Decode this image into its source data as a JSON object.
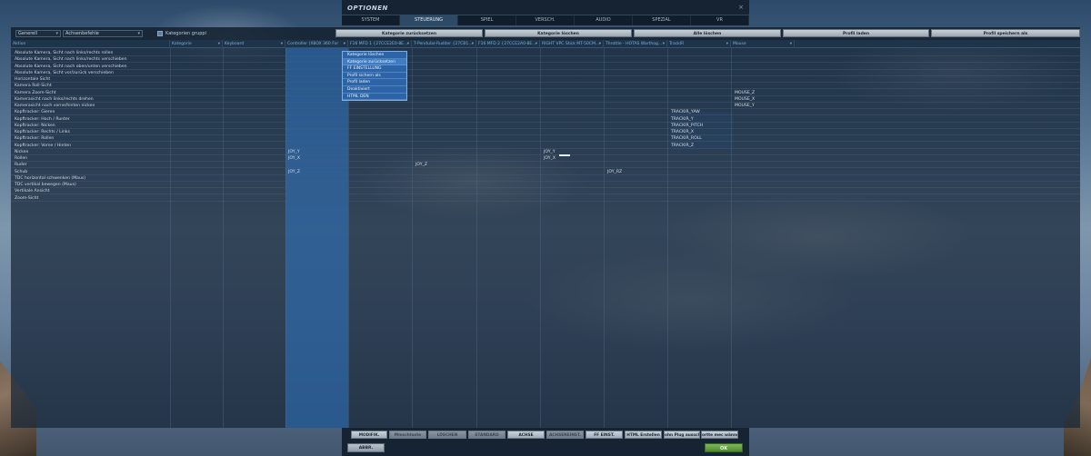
{
  "window": {
    "title": "OPTIONEN",
    "close": "×"
  },
  "tabs": [
    "SYSTEM",
    "STEUERUNG",
    "SPIEL",
    "VERSCH.",
    "AUDIO",
    "SPEZIAL",
    "VR"
  ],
  "active_tab": "STEUERUNG",
  "toolbar": {
    "aircraft_select": "Generell",
    "category_select": "Achsenbefehle",
    "group_checkbox_label": "Kategorien gruppi",
    "buttons": [
      "Kategorie zurücksetzen",
      "Kategorie löschen",
      "Alle löschen",
      "Profil laden",
      "Profil speichern als"
    ]
  },
  "columns": [
    "Aktion",
    "Kategorie",
    "Keyboard",
    "Controller (XBOX 360 For",
    "F16 MFD 1 {27CCE2E0-8E...",
    "T-Pendular-Rudder {27CB1...",
    "F16 MFD 2 {27CCE2A0-8E...",
    "RIGHT VPC Stick MT-50CM...",
    "Throttle - HOTAS Warthog...",
    "TrackIR",
    "Mouse"
  ],
  "rows": [
    {
      "action": "Absolute Kamera, Sicht nach links/rechts rollen",
      "values": {}
    },
    {
      "action": "Absolute Kamera, Sicht nach links/rechts verschieben",
      "values": {}
    },
    {
      "action": "Absolute Kamera, Sicht nach oben/unten verschieben",
      "values": {}
    },
    {
      "action": "Absolute Kamera, Sicht vor/zurück verschieben",
      "values": {}
    },
    {
      "action": "Horizontale Sicht",
      "values": {}
    },
    {
      "action": "Kamera Roll-Sicht",
      "values": {}
    },
    {
      "action": "Kamera Zoom-Sicht",
      "values": {
        "mouse": "MOUSE_Z"
      }
    },
    {
      "action": "Kamerasicht nach links/rechts drehen",
      "values": {
        "mouse": "MOUSE_X"
      }
    },
    {
      "action": "Kamerasicht nach vorne/hinten nicken",
      "values": {
        "mouse": "MOUSE_Y"
      }
    },
    {
      "action": "Kopftracker: Gieren",
      "values": {
        "trackir": "TRACKIR_YAW"
      }
    },
    {
      "action": "Kopftracker: Hoch / Runter",
      "values": {
        "trackir": "TRACKIR_Y"
      }
    },
    {
      "action": "Kopftracker: Nicken",
      "values": {
        "trackir": "TRACKIR_PITCH"
      }
    },
    {
      "action": "Kopftracker: Rechts / Links",
      "values": {
        "trackir": "TRACKIR_X"
      }
    },
    {
      "action": "Kopftracker: Rollen",
      "values": {
        "trackir": "TRACKIR_ROLL"
      }
    },
    {
      "action": "Kopftracker: Vorne / Hinten",
      "values": {
        "trackir": "TRACKIR_Z"
      }
    },
    {
      "action": "Nicken",
      "values": {
        "xbox": "JOY_Y",
        "stick": "JOY_Y"
      }
    },
    {
      "action": "Rollen",
      "values": {
        "xbox": "JOY_X",
        "stick": "JOY_X"
      }
    },
    {
      "action": "Ruder",
      "values": {
        "rudder": "JOY_Z"
      }
    },
    {
      "action": "Schub",
      "values": {
        "xbox": "JOY_Z",
        "throttle": "JOY_RZ"
      }
    },
    {
      "action": "TDC horizontal schwenken (Maus)",
      "values": {}
    },
    {
      "action": "TDC vertikal bewegen (Maus)",
      "values": {}
    },
    {
      "action": "Vertikale Ansicht",
      "values": {}
    },
    {
      "action": "Zoom-Sicht",
      "values": {}
    }
  ],
  "context_menu": [
    "Kategorie löschen",
    "Kategorie zurücksetzen",
    "FF EINSTELLUNG",
    "Profil sichern als",
    "Profil laden",
    "Deaktiviert",
    "HTML DEN"
  ],
  "bottom_buttons": [
    {
      "label": "MODIFIK.",
      "enabled": true
    },
    {
      "label": "Mmschtaste",
      "enabled": false
    },
    {
      "label": "LÖSCHEN",
      "enabled": false
    },
    {
      "label": "STANDARD",
      "enabled": false
    },
    {
      "label": "ACHSE",
      "enabled": true
    },
    {
      "label": "ACHSENEINST.",
      "enabled": false
    },
    {
      "label": "FF EINST.",
      "enabled": true
    },
    {
      "label": "HTML Erstellen",
      "enabled": true
    },
    {
      "label": "ohn Plug ausschalte",
      "enabled": true
    },
    {
      "label": "ortte mec wänne",
      "enabled": true
    }
  ],
  "footer": {
    "cancel": "ABBR.",
    "ok": "OK"
  },
  "colors": {
    "accent": "#2c4a66",
    "highlight_column": "#3076c4",
    "header_text": "#74b4de",
    "ok_green": "#5b9a3a"
  }
}
